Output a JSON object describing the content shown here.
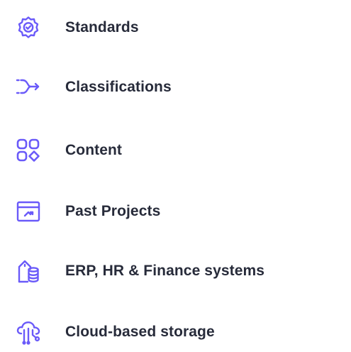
{
  "accent_color": "#6a5af9",
  "text_color": "#272b3a",
  "items": [
    {
      "icon": "settings-gear-icon",
      "label": "Standards"
    },
    {
      "icon": "flow-arrow-icon",
      "label": "Classifications"
    },
    {
      "icon": "grid-shapes-icon",
      "label": "Content"
    },
    {
      "icon": "folder-chart-icon",
      "label": "Past Projects"
    },
    {
      "icon": "building-database-icon",
      "label": "ERP, HR & Finance systems"
    },
    {
      "icon": "cloud-network-icon",
      "label": "Cloud-based storage"
    }
  ]
}
